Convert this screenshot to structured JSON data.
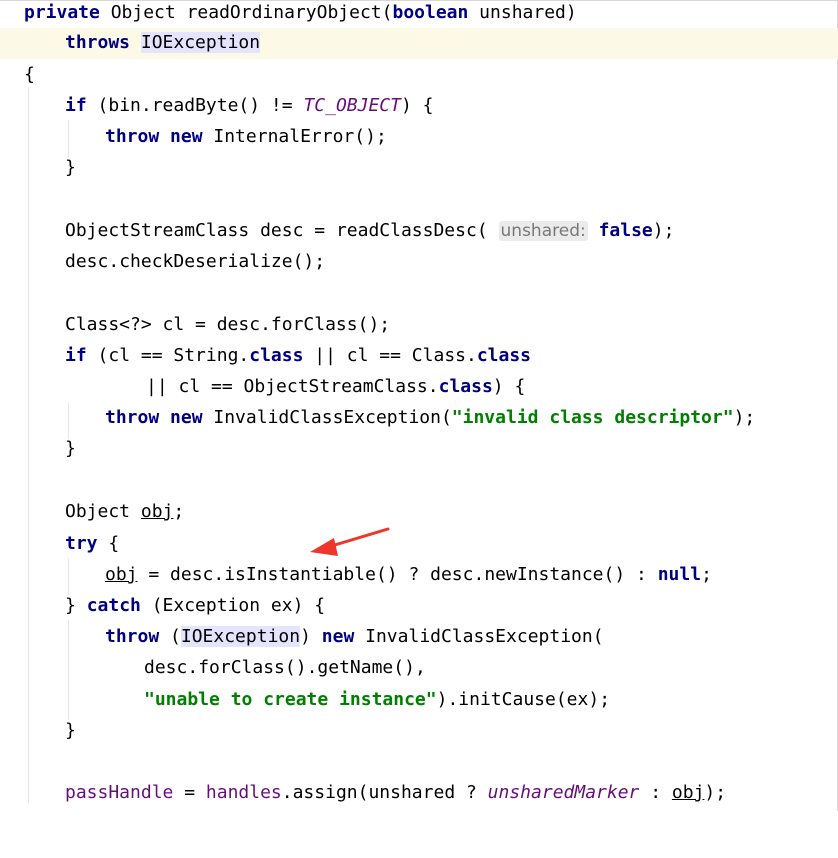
{
  "code": {
    "l1": {
      "private": "private",
      "Object": " Object ",
      "method": "readOrdinaryObject",
      "open": "(",
      "boolean": "boolean",
      "rest": " unshared)"
    },
    "l2": {
      "throws": "throws",
      "space": " ",
      "exc": "IOException"
    },
    "l3": {
      "brace": "{"
    },
    "l4": {
      "if": "if",
      "p1": " (bin.",
      "m": "readByte",
      "p2": "() != ",
      "const": "TC_OBJECT",
      "p3": ") {"
    },
    "l5": {
      "throw": "throw",
      "sp": " ",
      "new": "new",
      "rest": " InternalError();"
    },
    "l6": {
      "brace": "}"
    },
    "l7": {
      "p1": "ObjectStreamClass desc = ",
      "m": "readClassDesc",
      "p2": "( ",
      "hint": "unshared:",
      "sp": " ",
      "false": "false",
      "p3": ");"
    },
    "l8": {
      "p1": "desc.",
      "m": "checkDeserialize",
      "p2": "();"
    },
    "l9": {
      "p1": "Class<?> cl = desc.",
      "m": "forClass",
      "p2": "();"
    },
    "l10": {
      "if": "if",
      "p1": " (cl == String.",
      "c1": "class",
      "p2": " || cl == Class.",
      "c2": "class"
    },
    "l11": {
      "p1": "|| cl == ObjectStreamClass.",
      "c": "class",
      "p2": ") {"
    },
    "l12": {
      "throw": "throw",
      "sp": " ",
      "new": "new",
      "p1": " InvalidClassException(",
      "str": "\"invalid class descriptor\"",
      "p2": ");"
    },
    "l13": {
      "brace": "}"
    },
    "l14": {
      "p1": "Object ",
      "obj": "obj",
      "p2": ";"
    },
    "l15": {
      "try": "try",
      "p1": " {"
    },
    "l16": {
      "obj": "obj",
      "p1": " = desc.",
      "m1": "isInstantiable",
      "p2": "() ? desc.",
      "m2": "newInstance",
      "p3": "() : ",
      "null": "null",
      "p4": ";"
    },
    "l17": {
      "p0": "} ",
      "catch": "catch",
      "p1": " (Exception ex) {"
    },
    "l18": {
      "throw": "throw",
      "p1": " (",
      "exc": "IOException",
      "p2": ") ",
      "new": "new",
      "p3": " InvalidClassException("
    },
    "l19": {
      "p1": "desc.",
      "m1": "forClass",
      "p2": "().",
      "m2": "getName",
      "p3": "(),"
    },
    "l20": {
      "str": "\"unable to create instance\"",
      "p1": ").",
      "m": "initCause",
      "p2": "(ex);"
    },
    "l21": {
      "brace": "}"
    },
    "l22": {
      "fld": "passHandle",
      "p1": " = ",
      "fld2": "handles",
      "p2": ".",
      "m": "assign",
      "p3": "(unshared ? ",
      "const": "unsharedMarker",
      "p4": " : ",
      "obj": "obj",
      "p5": ");"
    }
  },
  "colors": {
    "keyword": "#000080",
    "string": "#008000",
    "field": "#660e7a",
    "arrow": "#f0352a",
    "caret_line": "#fcfae6"
  }
}
